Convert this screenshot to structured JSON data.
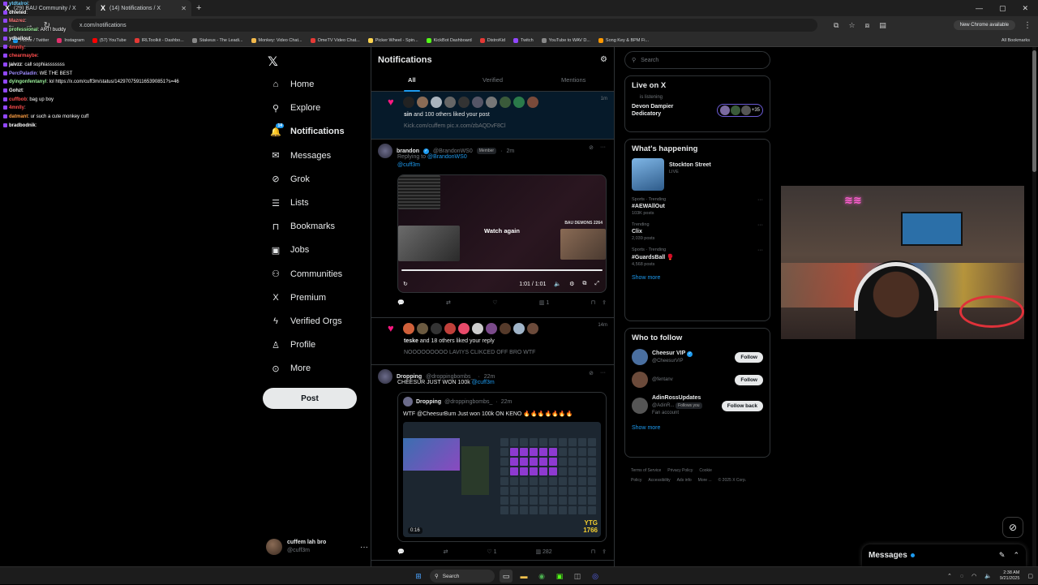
{
  "browser": {
    "tabs": [
      {
        "label": "(29) BAU Community / X",
        "active": false
      },
      {
        "label": "(14) Notifications / X",
        "active": true
      }
    ],
    "url": "x.com/notifications",
    "new_chrome_label": "New Chrome available",
    "bookmarks": [
      {
        "label": "Home / Twitter",
        "color": "#1d9bf0"
      },
      {
        "label": "Instagram",
        "color": "#e1306c"
      },
      {
        "label": "(57) YouTube",
        "color": "#ff0000"
      },
      {
        "label": "IRLToolkit - Dashbo...",
        "color": "#e53935"
      },
      {
        "label": "Stakeus - The Leadi...",
        "color": "#888888"
      },
      {
        "label": "Monkey: Video Chat...",
        "color": "#f2b84b"
      },
      {
        "label": "OmeTV Video Chat...",
        "color": "#e53935"
      },
      {
        "label": "Picker Wheel - Spin...",
        "color": "#ffd54f"
      },
      {
        "label": "KickBot Dashboard",
        "color": "#53fc18"
      },
      {
        "label": "DistroKid",
        "color": "#e53935"
      },
      {
        "label": "Twitch",
        "color": "#9147ff"
      },
      {
        "label": "YouTube to WAV D...",
        "color": "#888888"
      },
      {
        "label": "Song Key & BPM Fi...",
        "color": "#ff9800"
      }
    ],
    "all_bookmarks": "All Bookmarks"
  },
  "chat": [
    {
      "user": "ytdtalroi",
      "msg": "",
      "color": "#6fd0ff"
    },
    {
      "user": "dhleted",
      "msg": "",
      "color": "#ffffff"
    },
    {
      "user": "Mazrez",
      "msg": "",
      "color": "#ff7b7b"
    },
    {
      "user": "professional",
      "msg": "ART! buddy",
      "color": "#9ef59e"
    },
    {
      "user": "ydballout",
      "msg": "",
      "color": "#ffffff"
    },
    {
      "user": "4mnlly",
      "msg": "",
      "color": "#ff4d4d"
    },
    {
      "user": "chearmaybe",
      "msg": "",
      "color": "#ff4d4d"
    },
    {
      "user": "jaivzz",
      "msg": "call sophiasssssss",
      "color": "#ffffff"
    },
    {
      "user": "PercPaladin",
      "msg": "WE THE BEST",
      "color": "#9f8cff"
    },
    {
      "user": "dyingonfentanyl",
      "msg": "lol https://x.com/cuff3m/status/1429707591165390851?s=46",
      "color": "#9ef59e"
    },
    {
      "user": "Gohzt",
      "msg": "",
      "color": "#ffffff"
    },
    {
      "user": "cuffbob",
      "msg": "bag up boy",
      "color": "#ff4d4d"
    },
    {
      "user": "4mnlly",
      "msg": "",
      "color": "#ff4d4d"
    },
    {
      "user": "datmant",
      "msg": "ur such a cute monkey cuff",
      "color": "#ff9f43"
    },
    {
      "user": "bradbodnik",
      "msg": "",
      "color": "#ffffff"
    }
  ],
  "nav": {
    "items": [
      {
        "label": "Home",
        "icon": "home-icon",
        "glyph": "⌂",
        "bold": false
      },
      {
        "label": "Explore",
        "icon": "search-icon",
        "glyph": "⚲",
        "bold": false
      },
      {
        "label": "Notifications",
        "icon": "bell-icon",
        "glyph": "🔔",
        "bold": true,
        "badge": "14"
      },
      {
        "label": "Messages",
        "icon": "mail-icon",
        "glyph": "✉",
        "bold": false
      },
      {
        "label": "Grok",
        "icon": "grok-icon",
        "glyph": "⊘",
        "bold": false
      },
      {
        "label": "Lists",
        "icon": "list-icon",
        "glyph": "☰",
        "bold": false
      },
      {
        "label": "Bookmarks",
        "icon": "bookmark-icon",
        "glyph": "⊓",
        "bold": false
      },
      {
        "label": "Jobs",
        "icon": "briefcase-icon",
        "glyph": "▣",
        "bold": false
      },
      {
        "label": "Communities",
        "icon": "people-icon",
        "glyph": "⚇",
        "bold": false
      },
      {
        "label": "Premium",
        "icon": "x-icon",
        "glyph": "X",
        "bold": false
      },
      {
        "label": "Verified Orgs",
        "icon": "lightning-icon",
        "glyph": "ϟ",
        "bold": false
      },
      {
        "label": "Profile",
        "icon": "person-icon",
        "glyph": "♙",
        "bold": false
      },
      {
        "label": "More",
        "icon": "more-circle-icon",
        "glyph": "⊙",
        "bold": false
      }
    ],
    "post_label": "Post",
    "account": {
      "name": "cuffem lah bro",
      "handle": "@cuff3m"
    }
  },
  "center": {
    "title": "Notifications",
    "tabs": [
      "All",
      "Verified",
      "Mentions"
    ],
    "notif1": {
      "time": "1m",
      "text": "and 100 others liked your post",
      "actor": "sin",
      "sub": "Kick.com/cuffem pic.x.com/zbAQDvF8Cl"
    },
    "tweet1": {
      "name": "brandon",
      "handle": "@BrandonWS0",
      "badge": "Member",
      "time": "2m",
      "reply_label": "Replying to",
      "reply_to": "@BrandonWS0",
      "mention": "@cuff3m",
      "video": {
        "overlay": "Watch again",
        "time": "1:01 / 1:01",
        "corner": "BAU DEMONS 2264"
      },
      "likes": "1"
    },
    "notif2": {
      "time": "14m",
      "actor": "teske",
      "text": "and 18 others liked your reply",
      "sub": "NOOOOOOOOO LAVIYS CLIKCED OFF BRO WTF"
    },
    "tweet2": {
      "name": "Dropping",
      "handle": "@droppingbombs_",
      "time": "22m",
      "text": "CHEESUR JUST WON 100k",
      "mention": "@cuff3m",
      "quote": {
        "name": "Dropping",
        "handle": "@droppingbombs_",
        "time": "22m",
        "text": "WTF @CheesurBurn Just won 100k ON KENO 🔥🔥🔥🔥🔥🔥🔥",
        "duration": "0:16",
        "brand": "YTG",
        "brand2": "1766"
      },
      "likes": "1",
      "views": "282"
    }
  },
  "right": {
    "search_placeholder": "Search",
    "live": {
      "title": "Live on X",
      "listening": "is listening",
      "host": "Devon Dampier",
      "host2": "Dedicatory",
      "count": "+35"
    },
    "happening": {
      "title": "What's happening",
      "event": {
        "name": "Stockton Street",
        "status": "LIVE"
      },
      "trends": [
        {
          "cat": "Sports · Trending",
          "name": "#AEWAllOut",
          "count": "103K posts"
        },
        {
          "cat": "Trending",
          "name": "Clix",
          "count": "2,039 posts"
        },
        {
          "cat": "Sports · Trending",
          "name": "#GuardsBall 🥊",
          "count": "4,568 posts"
        }
      ],
      "show_more": "Show more"
    },
    "who_to_follow": {
      "title": "Who to follow",
      "people": [
        {
          "name": "Cheesur VIP",
          "handle": "@CheesurVIP",
          "button": "Follow",
          "verified": true,
          "color": "#4a6fa0"
        },
        {
          "name": "",
          "handle": "@fentanv",
          "button": "Follow",
          "verified": false,
          "color": "#6b4a3a"
        },
        {
          "name": "AdinRossUpdates",
          "handle": "@AdinR...",
          "extra": "Follows you",
          "button": "Follow back",
          "sub": "Fan account",
          "verified": false,
          "color": "#555"
        }
      ],
      "show_more": "Show more"
    },
    "footer": [
      "Terms of Service",
      "Privacy Policy",
      "Cookie Policy",
      "Accessibility",
      "Ads info",
      "More ...",
      "© 2025 X Corp."
    ]
  },
  "messages_drawer": {
    "title": "Messages"
  },
  "taskbar": {
    "search": "Search",
    "time": "2:38 AM",
    "date": "9/21/2025"
  }
}
